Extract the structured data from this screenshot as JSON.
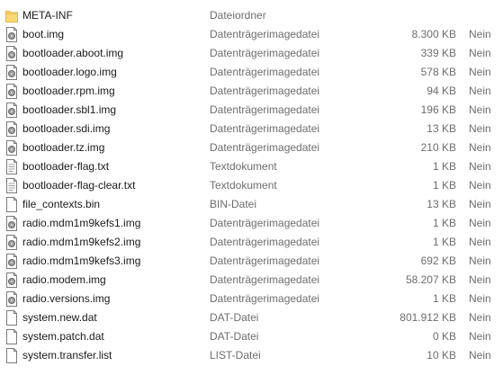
{
  "files": [
    {
      "name": "META-INF",
      "type": "Dateiordner",
      "size": "",
      "compressed": "",
      "icon": "folder-icon"
    },
    {
      "name": "boot.img",
      "type": "Datenträgerimagedatei",
      "size": "8.300 KB",
      "compressed": "Nein",
      "icon": "disk-image-icon"
    },
    {
      "name": "bootloader.aboot.img",
      "type": "Datenträgerimagedatei",
      "size": "339 KB",
      "compressed": "Nein",
      "icon": "disk-image-icon"
    },
    {
      "name": "bootloader.logo.img",
      "type": "Datenträgerimagedatei",
      "size": "578 KB",
      "compressed": "Nein",
      "icon": "disk-image-icon"
    },
    {
      "name": "bootloader.rpm.img",
      "type": "Datenträgerimagedatei",
      "size": "94 KB",
      "compressed": "Nein",
      "icon": "disk-image-icon"
    },
    {
      "name": "bootloader.sbl1.img",
      "type": "Datenträgerimagedatei",
      "size": "196 KB",
      "compressed": "Nein",
      "icon": "disk-image-icon"
    },
    {
      "name": "bootloader.sdi.img",
      "type": "Datenträgerimagedatei",
      "size": "13 KB",
      "compressed": "Nein",
      "icon": "disk-image-icon"
    },
    {
      "name": "bootloader.tz.img",
      "type": "Datenträgerimagedatei",
      "size": "210 KB",
      "compressed": "Nein",
      "icon": "disk-image-icon"
    },
    {
      "name": "bootloader-flag.txt",
      "type": "Textdokument",
      "size": "1 KB",
      "compressed": "Nein",
      "icon": "text-document-icon"
    },
    {
      "name": "bootloader-flag-clear.txt",
      "type": "Textdokument",
      "size": "1 KB",
      "compressed": "Nein",
      "icon": "text-document-icon"
    },
    {
      "name": "file_contexts.bin",
      "type": "BIN-Datei",
      "size": "13 KB",
      "compressed": "Nein",
      "icon": "file-icon"
    },
    {
      "name": "radio.mdm1m9kefs1.img",
      "type": "Datenträgerimagedatei",
      "size": "1 KB",
      "compressed": "Nein",
      "icon": "disk-image-icon"
    },
    {
      "name": "radio.mdm1m9kefs2.img",
      "type": "Datenträgerimagedatei",
      "size": "1 KB",
      "compressed": "Nein",
      "icon": "disk-image-icon"
    },
    {
      "name": "radio.mdm1m9kefs3.img",
      "type": "Datenträgerimagedatei",
      "size": "692 KB",
      "compressed": "Nein",
      "icon": "disk-image-icon"
    },
    {
      "name": "radio.modem.img",
      "type": "Datenträgerimagedatei",
      "size": "58.207 KB",
      "compressed": "Nein",
      "icon": "disk-image-icon"
    },
    {
      "name": "radio.versions.img",
      "type": "Datenträgerimagedatei",
      "size": "1 KB",
      "compressed": "Nein",
      "icon": "disk-image-icon"
    },
    {
      "name": "system.new.dat",
      "type": "DAT-Datei",
      "size": "801.912 KB",
      "compressed": "Nein",
      "icon": "file-icon"
    },
    {
      "name": "system.patch.dat",
      "type": "DAT-Datei",
      "size": "0 KB",
      "compressed": "Nein",
      "icon": "file-icon"
    },
    {
      "name": "system.transfer.list",
      "type": "LIST-Datei",
      "size": "10 KB",
      "compressed": "Nein",
      "icon": "file-icon"
    }
  ],
  "colors": {
    "folder": "#f8d775",
    "folder_dark": "#e3b84c",
    "icon_outline": "#7a7a7a",
    "disc": "#9a9a9a"
  }
}
